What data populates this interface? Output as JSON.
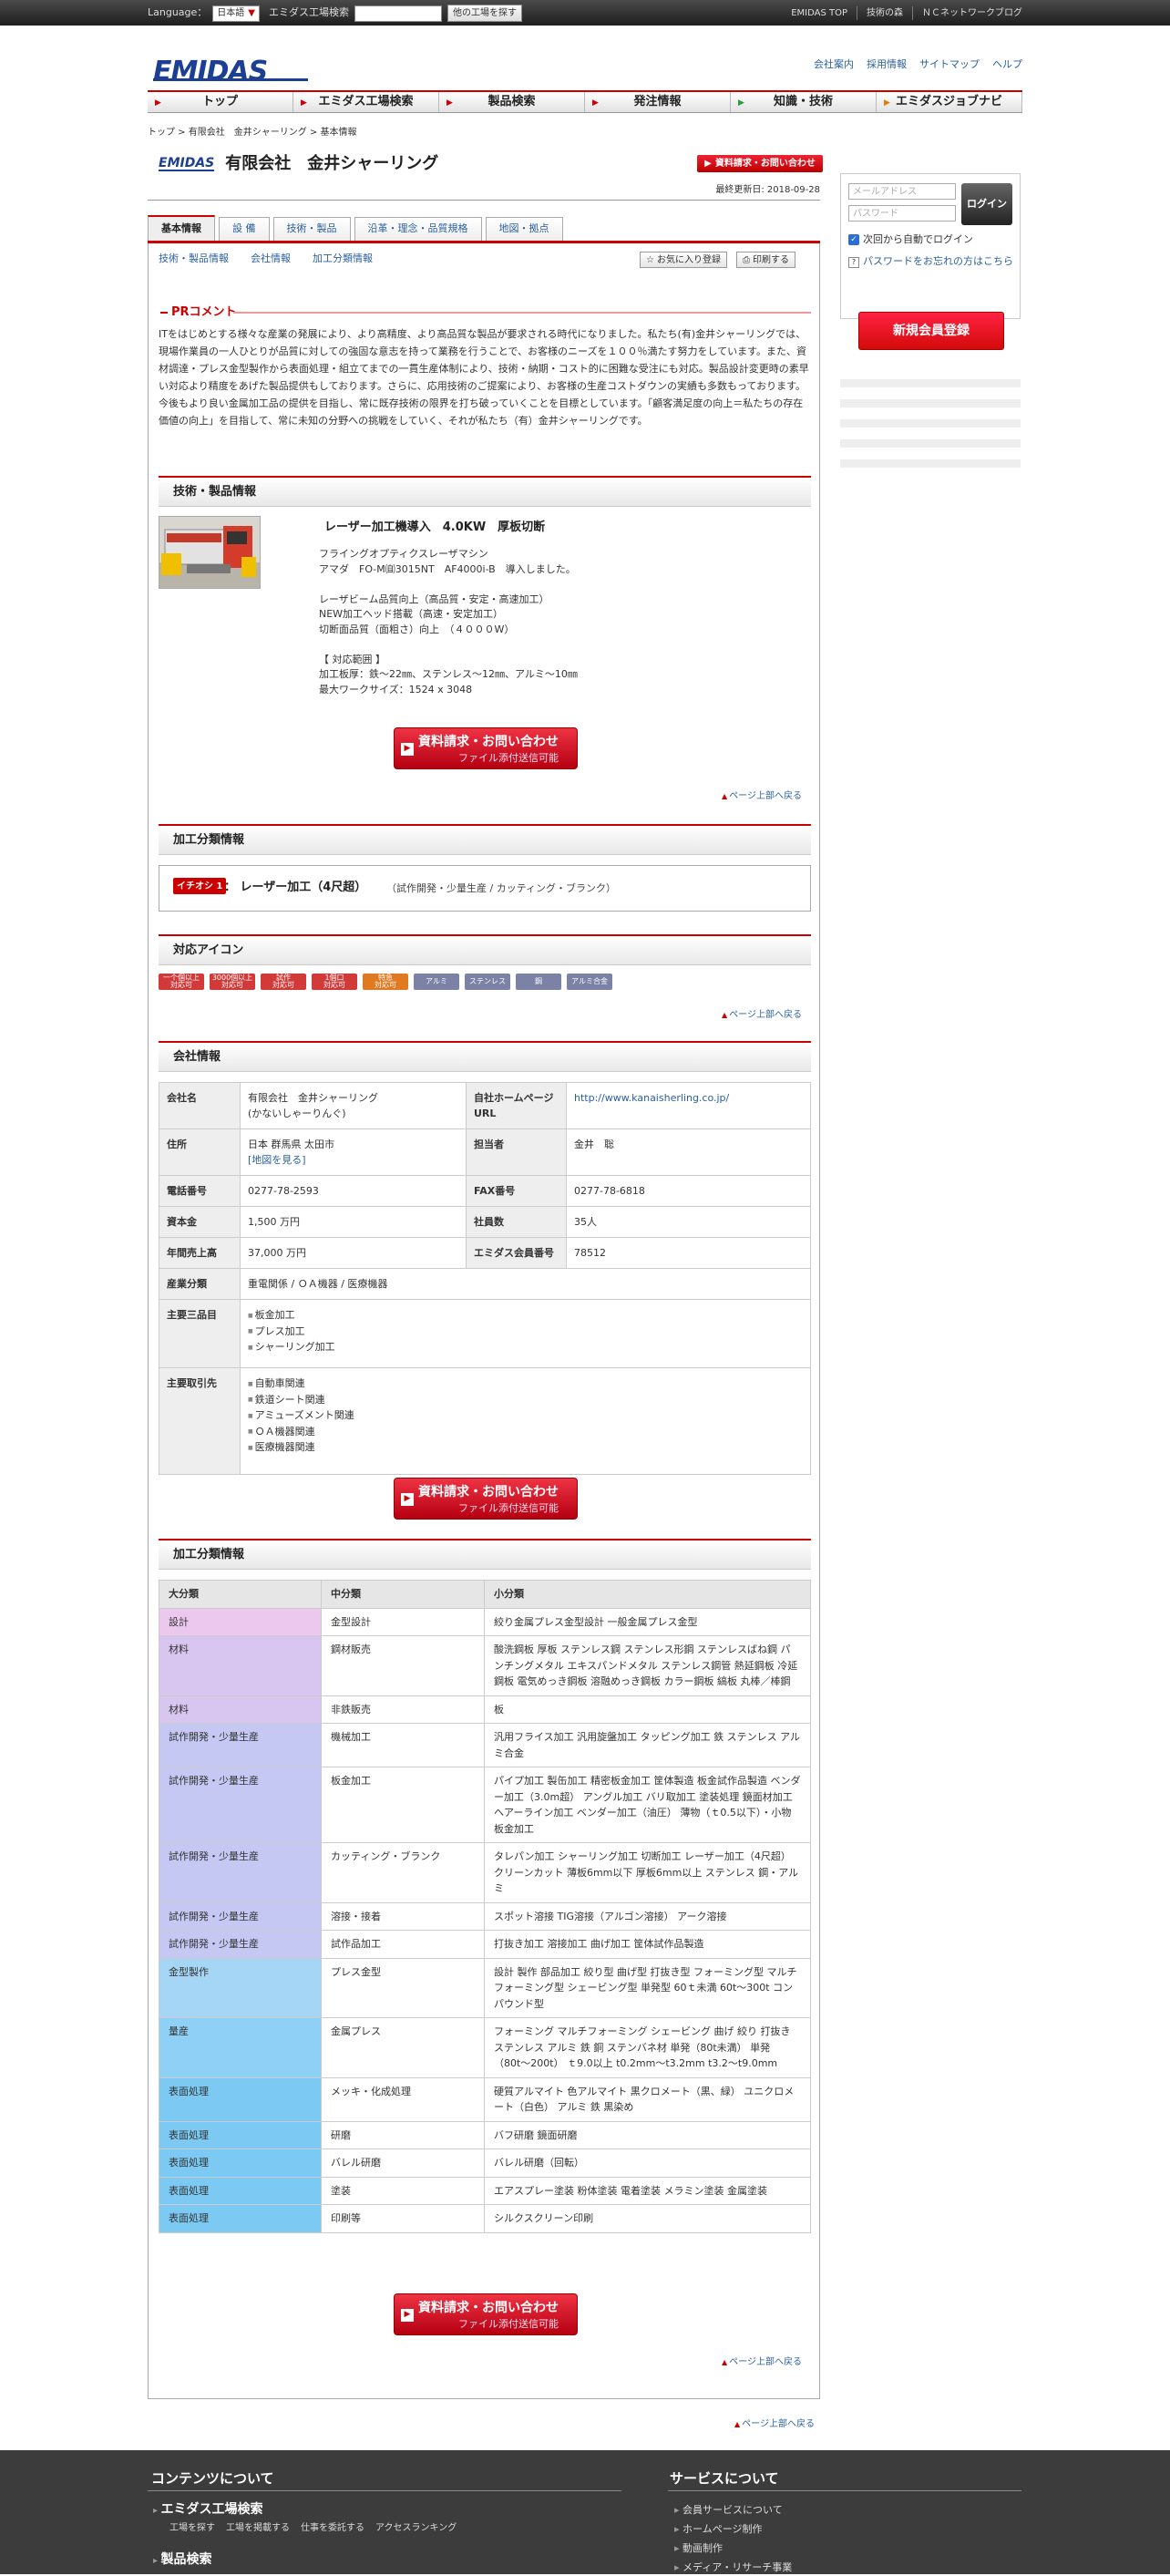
{
  "topbar": {
    "language_label": "Language：",
    "language_value": "日本語",
    "search_label": "エミダス工場検索",
    "search_button": "他の工場を探す",
    "links": [
      "EMIDAS TOP",
      "技術の森",
      "ＮＣネットワークブログ"
    ]
  },
  "header": {
    "logo": "EMIDAS",
    "links": [
      "会社案内",
      "採用情報",
      "サイトマップ",
      "ヘルプ"
    ]
  },
  "gnav": [
    "トップ",
    "エミダス工場検索",
    "製品検索",
    "発注情報",
    "知識・技術",
    "エミダスジョブナビ"
  ],
  "breadcrumb": "トップ > 有限会社　金井シャーリング > 基本情報",
  "company": {
    "mini_logo": "EMIDAS",
    "name": "有限会社　金井シャーリング",
    "request_button": "資料請求・お問い合わせ",
    "updated": "最終更新日: 2018-09-28"
  },
  "tabs": [
    "基本情報",
    "設 備",
    "技術・製品",
    "沿革・理念・品質規格",
    "地図・拠点"
  ],
  "sublinks": [
    "技術・製品情報",
    "会社情報",
    "加工分類情報"
  ],
  "actions": {
    "favorite": "お気に入り登録",
    "print": "印刷する"
  },
  "pr": {
    "heading": "PRコメント",
    "text": "ITをはじめとする様々な産業の発展により、より高精度、より高品質な製品が要求される時代になりました。私たち(有)金井シャーリングでは、現場作業員の一人ひとりが品質に対しての強固な意志を持って業務を行うことで、お客様のニーズを１００％満たす努力をしています。また、資材調達・プレス金型製作から表面処理・組立てまでの一貫生産体制により、技術・納期・コスト的に困難な受注にも対応。製品設計変更時の素早い対応より精度をあげた製品提供もしております。さらに、応用技術のご提案により、お客様の生産コストダウンの実績も多数もっております。今後もより良い金属加工品の提供を目指し、常に既存技術の限界を打ち破っていくことを目標としています。「顧客満足度の向上＝私たちの存在価値の向上」を目指して、常に未知の分野への挑戦をしていく、それが私たち（有）金井シャーリングです。"
  },
  "tech": {
    "heading": "技術・製品情報",
    "title": "レーザー加工機導入　4.0KW　厚板切断",
    "body": "フライングオプティクスレーザマシン\nアマダ　FO-M㉂3015NT　AF4000i-B　導入しました。\n\nレーザビーム品質向上（高品質・安定・高速加工）\nNEW加工ヘッド搭載（高速・安定加工）\n切断面品質（面粗さ）向上　（４０００W）\n\n【 対応範囲 】\n加工板厚：鉄〜22㎜、ステンレス〜12㎜、アルミ〜10㎜\n最大ワークサイズ：1524 x 3048"
  },
  "big_button": {
    "line1": "資料請求・お問い合わせ",
    "line2": "ファイル添付送信可能"
  },
  "pagetop": "ページ上部へ戻る",
  "proc": {
    "heading": "加工分類情報",
    "badge": "イチオシ 1",
    "main": "：  レーザー加工（4尺超）",
    "sub": "（試作開発・少量生産 / カッティング・ブランク）"
  },
  "icons": {
    "heading": "対応アイコン",
    "items": [
      {
        "label": "一个個以上\n対応可",
        "color": "#d23a3a"
      },
      {
        "label": "3000個以上\n対応可",
        "color": "#d23a3a"
      },
      {
        "label": "試作\n対応可",
        "color": "#d23a3a"
      },
      {
        "label": "1個口\n対応可",
        "color": "#d23a3a"
      },
      {
        "label": "特急\n対応可",
        "color": "#e07a22"
      },
      {
        "label": "アルミ",
        "color": "#7c82a6"
      },
      {
        "label": "ステンレス",
        "color": "#7c82a6"
      },
      {
        "label": "鋼",
        "color": "#7c82a6"
      },
      {
        "label": "アルミ合金",
        "color": "#7c82a6"
      }
    ]
  },
  "company_info": {
    "heading": "会社情報",
    "labels": {
      "name": "会社名",
      "hp": "自社ホームページURL",
      "address": "住所",
      "contact": "担当者",
      "tel": "電話番号",
      "fax": "FAX番号",
      "capital": "資本金",
      "employees": "社員数",
      "sales": "年間売上高",
      "member": "エミダス会員番号",
      "industry": "産業分類",
      "products": "主要三品目",
      "clients": "主要取引先"
    },
    "name": "有限会社　金井シャーリング\n(かないしゃーりんぐ)",
    "hp": "http://www.kanaisherling.co.jp/",
    "address": "日本 群馬県 太田市",
    "map": "[地図を見る]",
    "contact": "金井　聡",
    "tel": "0277-78-2593",
    "fax": "0277-78-6818",
    "capital": "1,500 万円",
    "employees": "35人",
    "sales": "37,000 万円",
    "member": "78512",
    "industry": "重電関係 / ＯＡ機器 / 医療機器",
    "products": [
      "板金加工",
      "プレス加工",
      "シャーリング加工"
    ],
    "clients": [
      "自動車関連",
      "鉄道シート関連",
      "アミューズメント関連",
      "ＯＡ機器関連",
      "医療機器関連"
    ]
  },
  "proc_table": {
    "heading": "加工分類情報",
    "headers": [
      "大分類",
      "中分類",
      "小分類"
    ],
    "rows": [
      {
        "c1": "設計",
        "c2": "金型設計",
        "c3": "絞り金属プレス金型設計 一般金属プレス金型",
        "color": "#ecc8ee"
      },
      {
        "c1": "材料",
        "c2": "鋼材販売",
        "c3": "酸洗鋼板 厚板 ステンレス鋼 ステンレス形鋼 ステンレスばね鋼 パンチングメタル エキスパンドメタル ステンレス鋼管 熱延鋼板 冷延鋼板 電気めっき鋼板 溶融めっき鋼板 カラー鋼板 縞板 丸棒／棒鋼",
        "color": "#d9c6f0"
      },
      {
        "c1": "材料",
        "c2": "非鉄販売",
        "c3": "板",
        "color": "#d9c6f0"
      },
      {
        "c1": "試作開発・少量生産",
        "c2": "機械加工",
        "c3": "汎用フライス加工 汎用旋盤加工 タッピング加工 鉄 ステンレス アルミ合金",
        "color": "#c4c8f2"
      },
      {
        "c1": "試作開発・少量生産",
        "c2": "板金加工",
        "c3": "パイプ加工 製缶加工 精密板金加工 筐体製造 板金試作品製造 ベンダー加工（3.0m超） アングル加工 バリ取加工 塗装処理 鏡面材加工 ヘアーライン加工 ベンダー加工（油圧） 薄物（ｔ0.5以下）・小物板金加工",
        "color": "#c4c8f2"
      },
      {
        "c1": "試作開発・少量生産",
        "c2": "カッティング・ブランク",
        "c3": "タレパン加工 シャーリング加工 切断加工 レーザー加工（4尺超） クリーンカット 薄板6mm以下 厚板6mm以上 ステンレス 鋼・アルミ",
        "color": "#c4c8f2"
      },
      {
        "c1": "試作開発・少量生産",
        "c2": "溶接・接着",
        "c3": "スポット溶接 TIG溶接（アルゴン溶接） アーク溶接",
        "color": "#c4c8f2"
      },
      {
        "c1": "試作開発・少量生産",
        "c2": "試作品加工",
        "c3": "打抜き加工 溶接加工 曲げ加工 筐体試作品製造",
        "color": "#c4c8f2"
      },
      {
        "c1": "金型製作",
        "c2": "プレス金型",
        "c3": "設計 製作 部品加工 絞り型 曲げ型 打抜き型 フォーミング型 マルチフォーミング型 シェービング型 単発型 60ｔ未満 60t〜300t コンパウンド型",
        "color": "#a6d6f6"
      },
      {
        "c1": "量産",
        "c2": "金属プレス",
        "c3": "フォーミング マルチフォーミング シェービング 曲げ 絞り 打抜き ステンレス アルミ 鉄 銅 ステンバネ材 単発（80t未満） 単発（80t〜200t） ｔ9.0以上 t0.2mm〜t3.2mm t3.2〜t9.0mm",
        "color": "#8fd0f6"
      },
      {
        "c1": "表面処理",
        "c2": "メッキ・化成処理",
        "c3": "硬質アルマイト 色アルマイト 黒クロメート（黒、緑） ユニクロメート（白色） アルミ 鉄 黒染め",
        "color": "#7ccaf3"
      },
      {
        "c1": "表面処理",
        "c2": "研磨",
        "c3": "バフ研磨 鏡面研磨",
        "color": "#7ccaf3"
      },
      {
        "c1": "表面処理",
        "c2": "バレル研磨",
        "c3": "バレル研磨（回転）",
        "color": "#7ccaf3"
      },
      {
        "c1": "表面処理",
        "c2": "塗装",
        "c3": "エアスプレー塗装 粉体塗装 電着塗装 メラミン塗装 金属塗装",
        "color": "#7ccaf3"
      },
      {
        "c1": "表面処理",
        "c2": "印刷等",
        "c3": "シルクスクリーン印刷",
        "color": "#7ccaf3"
      }
    ]
  },
  "side": {
    "email_placeholder": "メールアドレス",
    "password_placeholder": "パスワード",
    "login": "ログイン",
    "remember": "次回から自動でログイン",
    "forgot": "パスワードをお忘れの方はこちら",
    "register": "新規会員登録"
  },
  "footer": {
    "contents_heading": "コンテンツについて",
    "service_heading": "サービスについて",
    "factory_search": "エミダス工場検索",
    "factory_links": [
      "工場を探す",
      "工場を掲載する",
      "仕事を委託する",
      "アクセスランキング"
    ],
    "product_search": "製品検索",
    "services": [
      "会員サービスについて",
      "ホームページ制作",
      "動画制作",
      "メディア・リサーチ事業"
    ]
  }
}
